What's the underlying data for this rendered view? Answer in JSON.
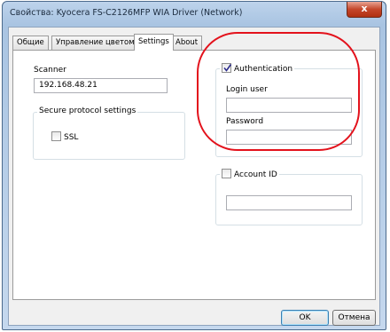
{
  "window": {
    "title": "Свойства: Kyocera FS-C2126MFP WIA Driver (Network)",
    "close_glyph": "x"
  },
  "tabs": [
    {
      "label": "Общие",
      "active": false
    },
    {
      "label": "Управление цветом",
      "active": false
    },
    {
      "label": "Settings",
      "active": true
    },
    {
      "label": "About",
      "active": false
    }
  ],
  "scanner": {
    "label": "Scanner",
    "address": "192.168.48.21"
  },
  "secure_protocol": {
    "legend": "Secure protocol settings",
    "ssl_label": "SSL",
    "ssl_checked": false
  },
  "authentication": {
    "label": "Authentication",
    "checked": true,
    "login_user_label": "Login user",
    "login_user_value": "",
    "password_label": "Password",
    "password_value": ""
  },
  "account": {
    "label": "Account ID",
    "checked": false,
    "value": ""
  },
  "buttons": {
    "ok": "OK",
    "cancel": "Отмена"
  },
  "colors": {
    "annotation": "#e3121c",
    "titlebar": "#bdd3eb",
    "close_button": "#c4462a"
  }
}
